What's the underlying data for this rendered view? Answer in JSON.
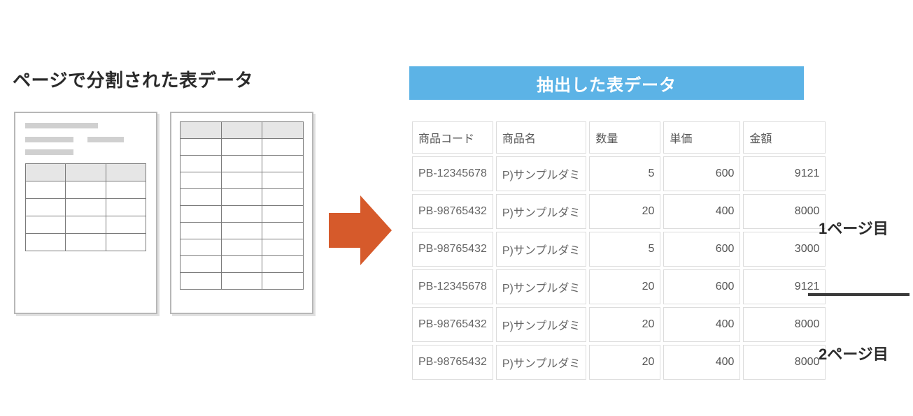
{
  "left_title": "ページで分割された表データ",
  "right_title": "抽出した表データ",
  "page_label_1": "1ページ目",
  "page_label_2": "2ページ目",
  "table": {
    "headers": [
      "商品コード",
      "商品名",
      "数量",
      "単価",
      "金額"
    ],
    "rows": [
      {
        "code": "PB-12345678",
        "name": "P)サンプルダミ",
        "qty": 5,
        "price": 600,
        "amount": 9121
      },
      {
        "code": "PB-98765432",
        "name": "P)サンプルダミ",
        "qty": 20,
        "price": 400,
        "amount": 8000
      },
      {
        "code": "PB-98765432",
        "name": "P)サンプルダミ",
        "qty": 5,
        "price": 600,
        "amount": 3000
      },
      {
        "code": "PB-12345678",
        "name": "P)サンプルダミ",
        "qty": 20,
        "price": 600,
        "amount": 9121
      },
      {
        "code": "PB-98765432",
        "name": "P)サンプルダミ",
        "qty": 20,
        "price": 400,
        "amount": 8000
      },
      {
        "code": "PB-98765432",
        "name": "P)サンプルダミ",
        "qty": 20,
        "price": 400,
        "amount": 8000
      }
    ]
  },
  "chart_data": {
    "type": "table",
    "title": "抽出した表データ",
    "columns": [
      "商品コード",
      "商品名",
      "数量",
      "単価",
      "金額"
    ],
    "rows": [
      [
        "PB-12345678",
        "P)サンプルダミ",
        5,
        600,
        9121
      ],
      [
        "PB-98765432",
        "P)サンプルダミ",
        20,
        400,
        8000
      ],
      [
        "PB-98765432",
        "P)サンプルダミ",
        5,
        600,
        3000
      ],
      [
        "PB-12345678",
        "P)サンプルダミ",
        20,
        600,
        9121
      ],
      [
        "PB-98765432",
        "P)サンプルダミ",
        20,
        400,
        8000
      ],
      [
        "PB-98765432",
        "P)サンプルダミ",
        20,
        400,
        8000
      ]
    ]
  },
  "colors": {
    "header_blue": "#5cb3e6",
    "arrow": "#d65a2b"
  }
}
